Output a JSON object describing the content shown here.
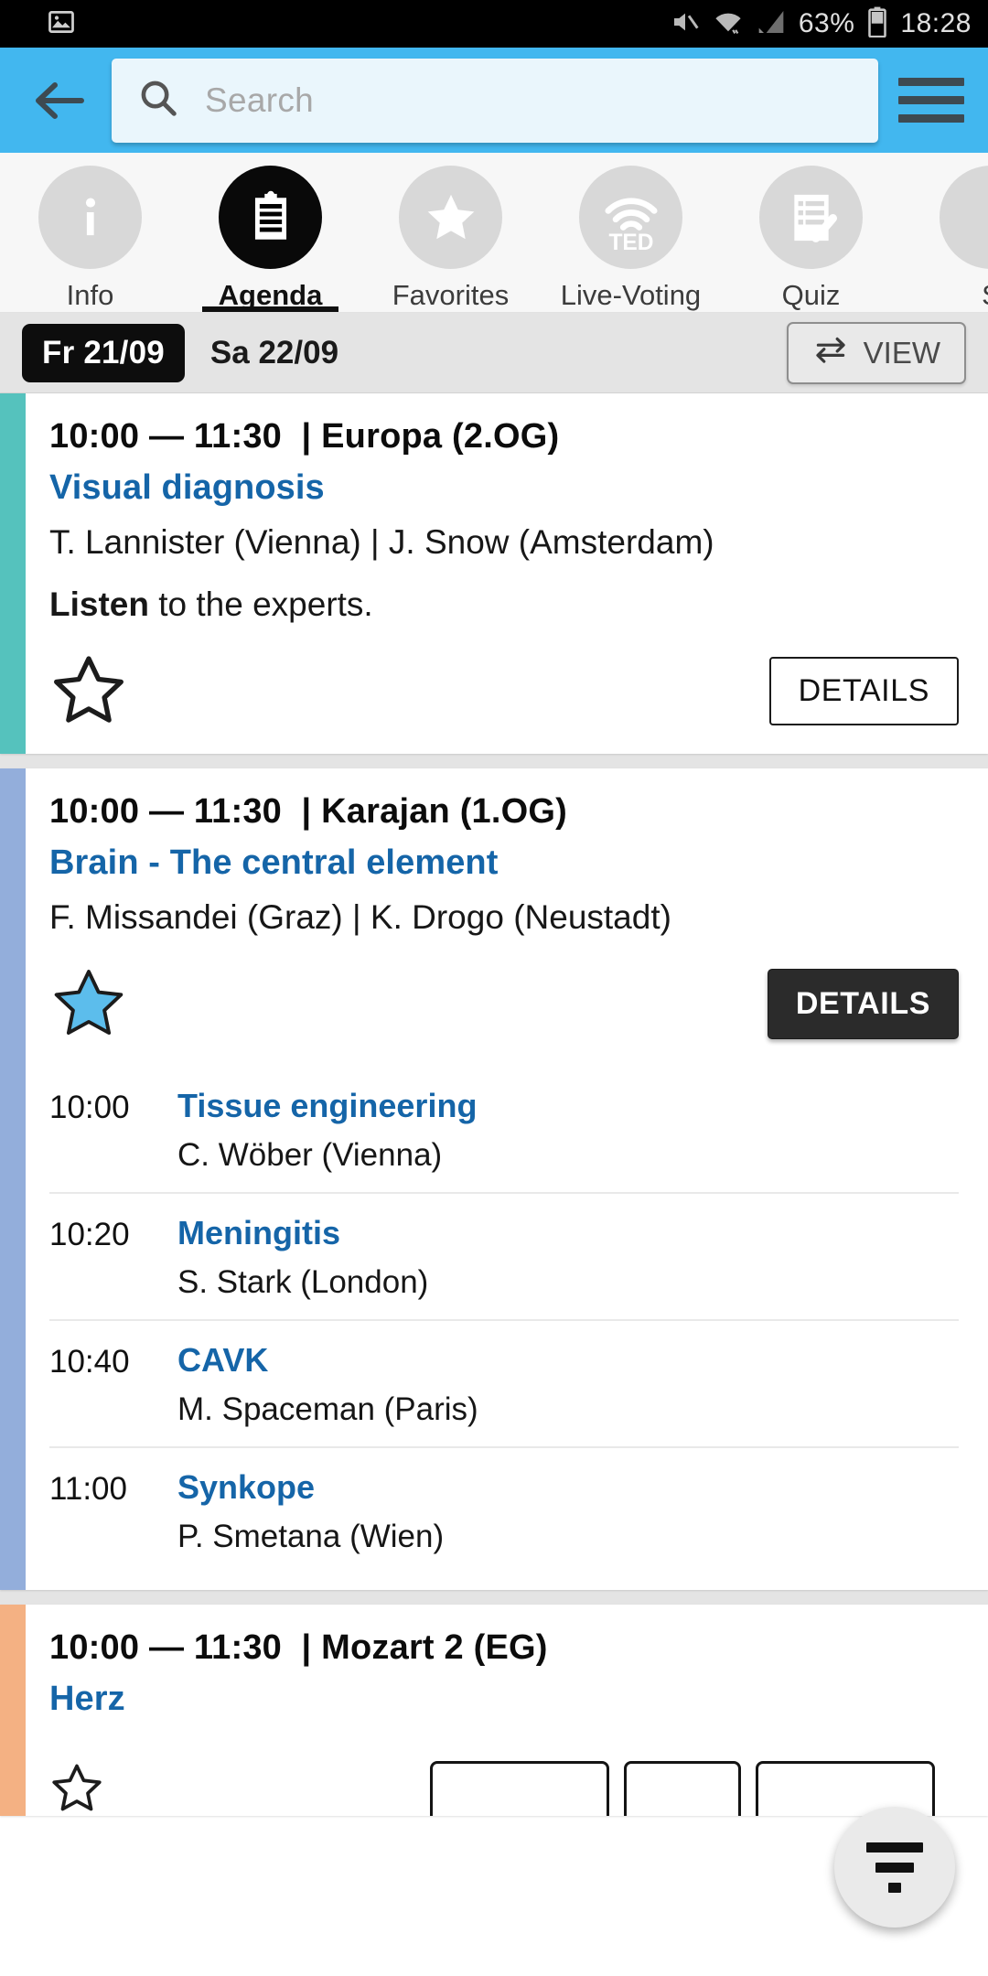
{
  "status_bar": {
    "left_icons": [
      "image-icon"
    ],
    "right_icons": [
      "mute-icon",
      "wifi-icon",
      "signal-icon",
      "battery-icon"
    ],
    "battery_percent": "63%",
    "time": "18:28"
  },
  "app_bar": {
    "back_icon": "back-arrow-icon",
    "search_placeholder": "Search",
    "search_value": "",
    "search_icon": "search-icon",
    "menu_icon": "hamburger-menu-icon"
  },
  "tabs": [
    {
      "label": "Info",
      "icon": "info-icon",
      "active": false
    },
    {
      "label": "Agenda",
      "icon": "clipboard-icon",
      "active": true
    },
    {
      "label": "Favorites",
      "icon": "star-icon",
      "active": false
    },
    {
      "label": "Live-Voting",
      "icon": "ted-wifi-icon",
      "active": false
    },
    {
      "label": "Quiz",
      "icon": "checklist-icon",
      "active": false
    },
    {
      "label": "S",
      "icon": "partial-icon",
      "active": false
    }
  ],
  "date_bar": {
    "dates": [
      {
        "label": "Fr 21/09",
        "selected": true
      },
      {
        "label": "Sa 22/09",
        "selected": false
      }
    ],
    "view_button": {
      "label": "VIEW",
      "icon": "swap-arrows-icon"
    }
  },
  "sessions": [
    {
      "stripe_color": "#55c2bd",
      "time": "10:00 — 11:30",
      "separator": "|",
      "room": "Europa (2.OG)",
      "title": "Visual diagnosis",
      "speakers": "T. Lannister (Vienna) | J. Snow (Amsterdam)",
      "note_bold": "Listen",
      "note_rest": " to the experts.",
      "favorited": false,
      "details_label": "DETAILS",
      "details_style": "outline",
      "sub_sessions": []
    },
    {
      "stripe_color": "#93aedb",
      "time": "10:00 — 11:30",
      "separator": "|",
      "room": "Karajan (1.OG)",
      "title": "Brain - The central element",
      "speakers": "F. Missandei (Graz) | K. Drogo (Neustadt)",
      "note_bold": "",
      "note_rest": "",
      "favorited": true,
      "details_label": "DETAILS",
      "details_style": "dark",
      "sub_sessions": [
        {
          "time": "10:00",
          "title": "Tissue engineering",
          "speaker": "C. Wöber (Vienna)"
        },
        {
          "time": "10:20",
          "title": "Meningitis",
          "speaker": "S. Stark (London)"
        },
        {
          "time": "10:40",
          "title": "CAVK",
          "speaker": "M. Spaceman (Paris)"
        },
        {
          "time": "11:00",
          "title": "Synkope",
          "speaker": "P. Smetana (Wien)"
        }
      ]
    },
    {
      "stripe_color": "#f4b183",
      "time": "10:00 — 11:30",
      "separator": "|",
      "room": "Mozart 2 (EG)",
      "title": "Herz",
      "speakers": "",
      "note_bold": "",
      "note_rest": "",
      "favorited": false,
      "details_label": "",
      "details_style": "outline",
      "sub_sessions": []
    }
  ],
  "fab": {
    "icon": "filter-icon",
    "name": "filter-fab"
  },
  "colors": {
    "app_bar": "#42b7ef",
    "accent_blue": "#1565a8",
    "favorite_star": "#5cbdec",
    "active_ring": "#c4173f",
    "date_pill": "#0d0d0d"
  }
}
